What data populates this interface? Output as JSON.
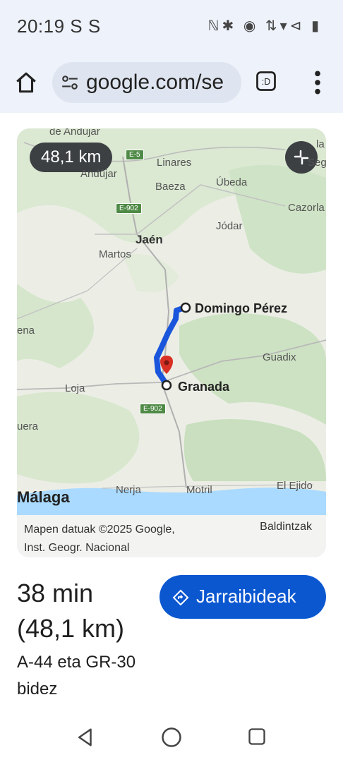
{
  "status_bar": {
    "time": "20:19 S S",
    "right_icons": "ℕ✱ ◉ ⇅▾⊲ ▮"
  },
  "browser": {
    "url": "google.com/se"
  },
  "map": {
    "distance_chip": "48,1 km",
    "places": {
      "andujar_top": "de Andújar",
      "andujar": "Andújar",
      "linares": "Linares",
      "baeza": "Baeza",
      "ubeda": "Úbeda",
      "cazorla": "Cazorla",
      "jodar": "Jódar",
      "jaen": "Jaén",
      "martos": "Martos",
      "domingo_perez": "Domingo Pérez",
      "guadix": "Guadix",
      "granada": "Granada",
      "loja": "Loja",
      "ena": "ena",
      "uera": "uera",
      "nerja": "Nerja",
      "motril": "Motril",
      "el_ejido": "El Ejido",
      "malaga": "Málaga",
      "seg": "Seg",
      "la": "la"
    },
    "roads": {
      "e5": "E-5",
      "e902_top": "E-902",
      "e902_bottom": "E-902"
    },
    "attribution_line1": "Mapen datuak ©2025 Google,",
    "attribution_line2": "Inst. Geogr. Nacional",
    "terms": "Baldintzak"
  },
  "route": {
    "duration": "38 min",
    "distance": "(48,1 km)",
    "via": "A-44 eta GR-30 bidez",
    "directions_label": "Jarraibideak"
  },
  "colors": {
    "route_blue": "#1a56db",
    "button_blue": "#0b57d0",
    "pin_red": "#d93025"
  }
}
